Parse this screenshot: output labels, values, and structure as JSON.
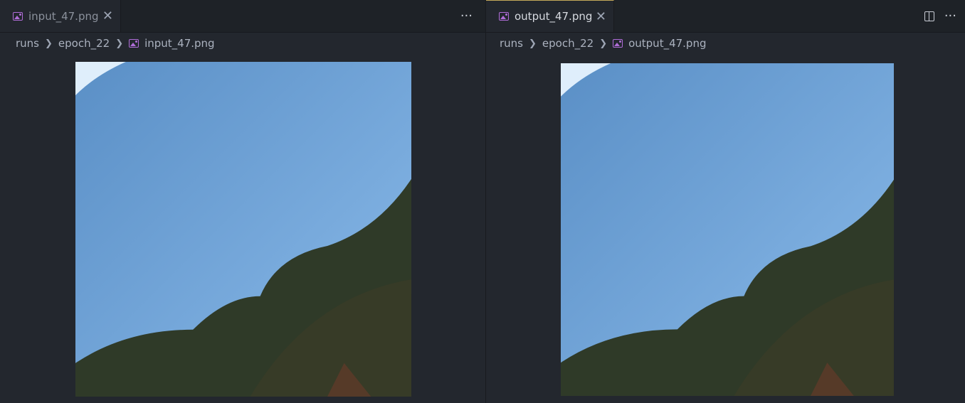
{
  "left": {
    "tab": {
      "label": "input_47.png",
      "close": "✕",
      "icon": "image-icon"
    },
    "actions": {
      "more": "···"
    },
    "breadcrumb": [
      "runs",
      "epoch_22",
      "input_47.png"
    ]
  },
  "right": {
    "tab": {
      "label": "output_47.png",
      "close": "✕",
      "icon": "image-icon"
    },
    "actions": {
      "split": "split-editor-icon",
      "more": "···"
    },
    "breadcrumb": [
      "runs",
      "epoch_22",
      "output_47.png"
    ]
  },
  "colors": {
    "background": "#23272e",
    "tab_active_border": "#c5a95a",
    "image_icon": "#b06dd8",
    "sky_top": "#5a8fc6",
    "sky_bottom": "#8bbbea",
    "foliage": "#2f3a28"
  }
}
